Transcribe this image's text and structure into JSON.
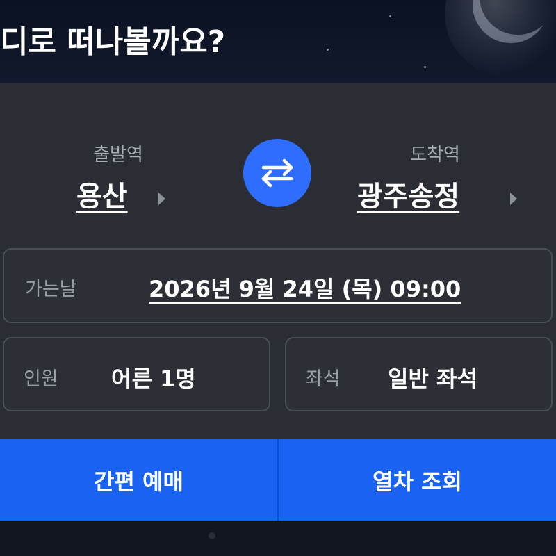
{
  "header": {
    "title": "디로 떠나볼까요?"
  },
  "departure": {
    "label": "출발역",
    "station": "용산"
  },
  "arrival": {
    "label": "도착역",
    "station": "광주송정"
  },
  "swap": {
    "icon": "swap-arrows-icon"
  },
  "date_field": {
    "label": "가는날",
    "value": "2026년 9월 24일 (목) 09:00"
  },
  "passengers_field": {
    "label": "인원",
    "value": "어른 1명"
  },
  "seat_field": {
    "label": "좌석",
    "value": "일반 좌석"
  },
  "actions": {
    "quick_booking": "간편 예매",
    "search_trains": "열차 조회"
  },
  "colors": {
    "accent": "#2f6dff",
    "button_blue": "#1a63f2",
    "panel": "#2a2d34",
    "header": "#0b1222"
  }
}
